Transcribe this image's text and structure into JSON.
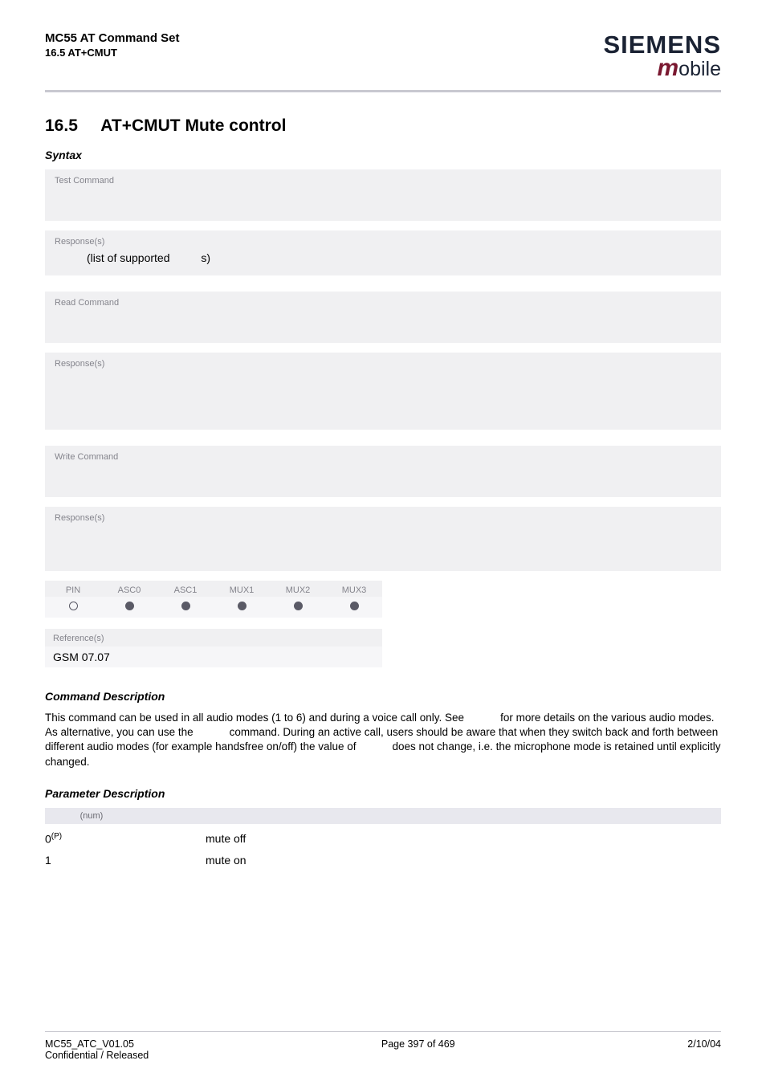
{
  "header": {
    "title": "MC55 AT Command Set",
    "subtitle": "16.5 AT+CMUT",
    "logo_top": "SIEMENS",
    "logo_bottom_m": "m",
    "logo_bottom_rest": "obile"
  },
  "section": {
    "number": "16.5",
    "title": "AT+CMUT   Mute control",
    "syntax_heading": "Syntax"
  },
  "blocks": {
    "test_cmd_label": "Test Command",
    "test_resp_label": "Response(s)",
    "test_resp_text1": "(list of supported ",
    "test_resp_text2": "s)",
    "read_cmd_label": "Read Command",
    "read_resp_label": "Response(s)",
    "write_cmd_label": "Write Command",
    "write_resp_label": "Response(s)"
  },
  "pin": {
    "h0": "PIN",
    "h1": "ASC0",
    "h2": "ASC1",
    "h3": "MUX1",
    "h4": "MUX2",
    "h5": "MUX3"
  },
  "ref": {
    "label": "Reference(s)",
    "value": "GSM 07.07"
  },
  "cmd_desc_heading": "Command Description",
  "cmd_desc_text_a": "This command can be used in all audio modes (1 to 6) and during a voice call only. See ",
  "cmd_desc_text_b": " for more details on the various audio modes. As alternative, you can use the ",
  "cmd_desc_text_c": " command. During an active call, users should be aware that when they switch back and forth between different audio modes (for example handsfree on/off) the value of ",
  "cmd_desc_text_d": " does not change, i.e. the microphone mode is retained until explicitly changed.",
  "param_desc_heading": "Parameter Description",
  "param_num": "(num)",
  "params": {
    "row0_key": "0",
    "row0_sup": "(P)",
    "row0_val": "mute off",
    "row1_key": "1",
    "row1_val": "mute on"
  },
  "footer": {
    "left1": "MC55_ATC_V01.05",
    "left2": "Confidential / Released",
    "center": "Page 397 of 469",
    "right": "2/10/04"
  }
}
